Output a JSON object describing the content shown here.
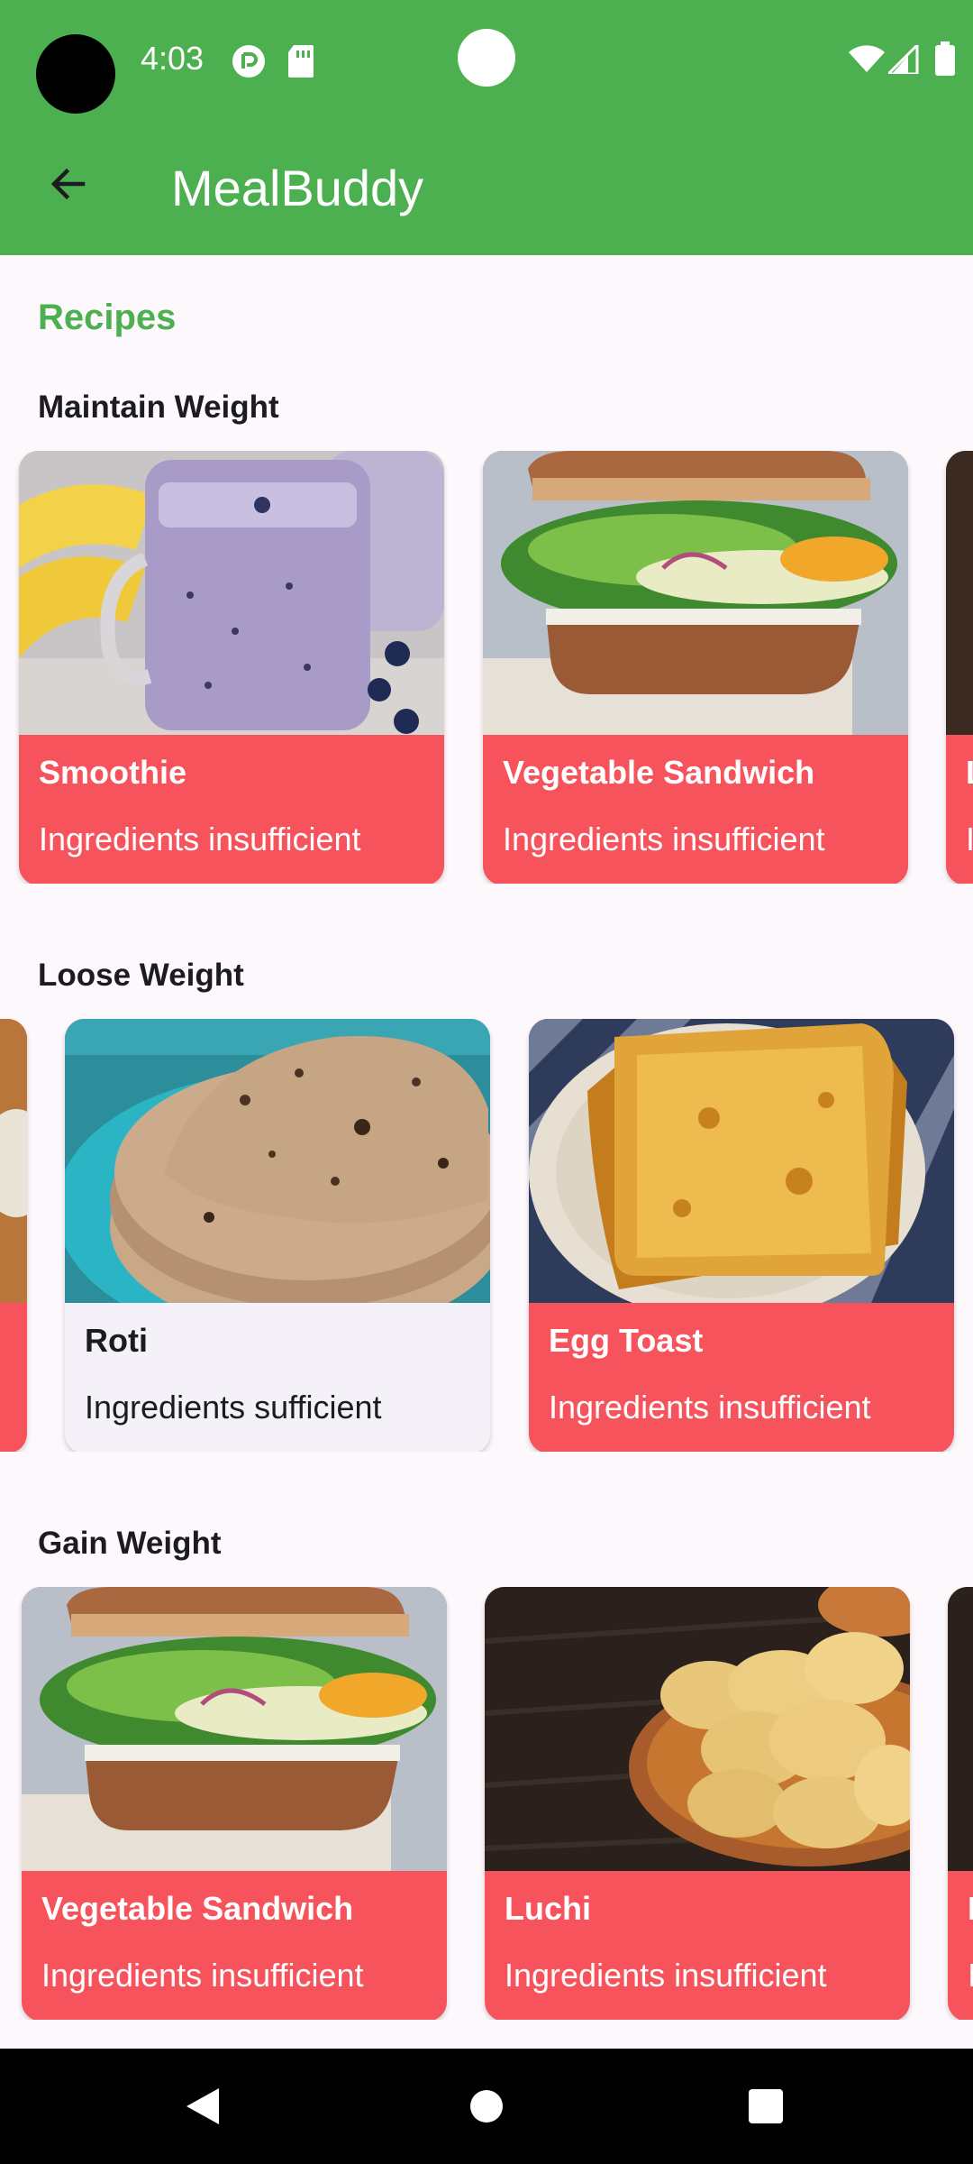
{
  "status_bar": {
    "time": "4:03",
    "icons": [
      "cloud-sync-icon",
      "sd-card-icon",
      "wifi-icon",
      "signal-icon",
      "battery-icon"
    ]
  },
  "app_bar": {
    "title": "MealBuddy",
    "back_icon": "arrow-back-icon"
  },
  "section_title": "Recipes",
  "rows": [
    {
      "title": "Maintain Weight",
      "cards": [
        {
          "name": "Smoothie",
          "status": "Ingredients insufficient",
          "image": "smoothie"
        },
        {
          "name": "Vegetable Sandwich",
          "status": "Ingredients insufficient",
          "image": "sandwich"
        },
        {
          "name": "L",
          "status": "I",
          "image": "dark"
        }
      ]
    },
    {
      "title": "Loose Weight",
      "cards": [
        {
          "name": "",
          "status": "",
          "image": "partial"
        },
        {
          "name": "Roti",
          "status": "Ingredients sufficient",
          "image": "roti"
        },
        {
          "name": "Egg Toast",
          "status": "Ingredients insufficient",
          "image": "toast"
        }
      ]
    },
    {
      "title": "Gain Weight",
      "cards": [
        {
          "name": "Vegetable Sandwich",
          "status": "Ingredients insufficient",
          "image": "sandwich"
        },
        {
          "name": "Luchi",
          "status": "Ingredients insufficient",
          "image": "luchi"
        },
        {
          "name": "L",
          "status": "I",
          "image": "dark"
        }
      ]
    }
  ],
  "nav_bar": {
    "buttons": [
      "back-triangle-icon",
      "home-circle-icon",
      "recents-square-icon"
    ]
  },
  "colors": {
    "primary": "#4caf50",
    "card_insufficient": "#f6535c",
    "card_sufficient": "#f4f1f8",
    "background": "#fdf8fc"
  }
}
